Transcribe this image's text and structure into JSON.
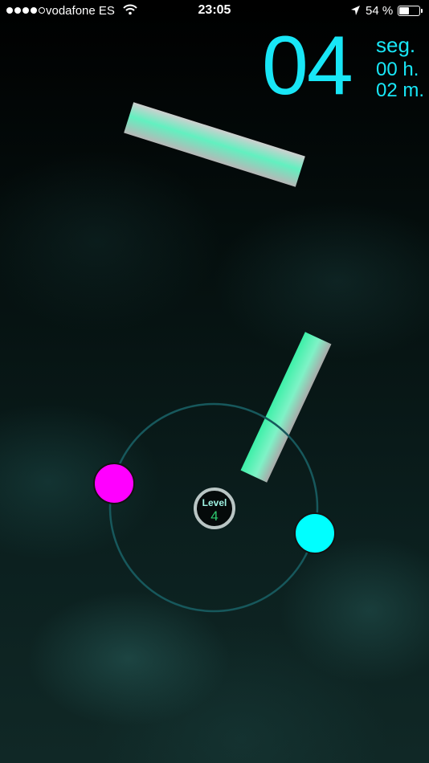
{
  "status_bar": {
    "carrier": "vodafone ES",
    "time": "23:05",
    "battery_percent": "54 %",
    "battery_level": 0.54,
    "signal_bars_filled": 4,
    "signal_bars_total": 5,
    "icons": [
      "wifi-icon",
      "location-arrow-icon",
      "battery-icon"
    ]
  },
  "timer": {
    "seconds": "04",
    "seconds_unit": "seg.",
    "hours": "00 h.",
    "minutes": "02 m.",
    "color": "#18e6f6"
  },
  "level": {
    "label": "Level",
    "number": "4"
  },
  "colors": {
    "orbit_ring": "#1a5a5e",
    "player_left": "#ff00ff",
    "player_right": "#00ffff",
    "bar_light": "#5ff5c0",
    "bar_grey": "#bdbdbd",
    "level_text": "#2ecc71",
    "level_label": "#9ff3e3"
  }
}
